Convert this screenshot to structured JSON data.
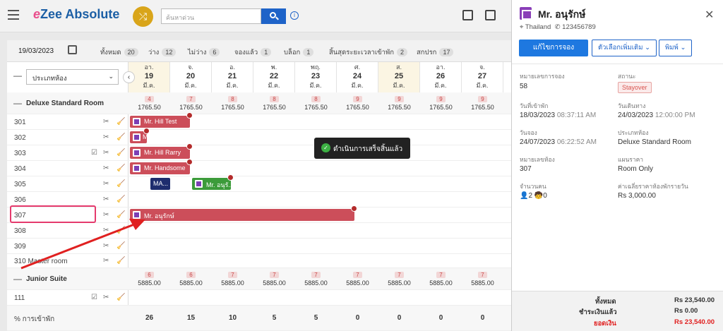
{
  "header": {
    "logo_e": "e",
    "logo_text": "Zee Absolute",
    "search_placeholder": "ค้นหาด่วน"
  },
  "filter": {
    "date": "19/03/2023",
    "stats": [
      {
        "label": "ทั้งหมด",
        "count": "20"
      },
      {
        "label": "ว่าง",
        "count": "12"
      },
      {
        "label": "ไม่ว่าง",
        "count": "6"
      },
      {
        "label": "จองแล้ว",
        "count": "1"
      },
      {
        "label": "บล็อก",
        "count": "1"
      },
      {
        "label": "สิ้นสุดระยะเวลาเข้าพัก",
        "count": "2"
      },
      {
        "label": "สกปรก",
        "count": "17"
      }
    ]
  },
  "grid": {
    "room_type_select": "ประเภทห้อง",
    "days": [
      {
        "dow": "อา.",
        "num": "19",
        "mon": "มี.ค."
      },
      {
        "dow": "จ.",
        "num": "20",
        "mon": "มี.ค."
      },
      {
        "dow": "อ.",
        "num": "21",
        "mon": "มี.ค."
      },
      {
        "dow": "พ.",
        "num": "22",
        "mon": "มี.ค."
      },
      {
        "dow": "พฤ.",
        "num": "23",
        "mon": "มี.ค."
      },
      {
        "dow": "ศ.",
        "num": "24",
        "mon": "มี.ค."
      },
      {
        "dow": "ส.",
        "num": "25",
        "mon": "มี.ค."
      },
      {
        "dow": "อา.",
        "num": "26",
        "mon": "มี.ค."
      },
      {
        "dow": "จ.",
        "num": "27",
        "mon": "มี.ค."
      }
    ],
    "deluxe": {
      "title": "Deluxe Standard Room",
      "avail": [
        "4",
        "7",
        "8",
        "8",
        "8",
        "9",
        "9",
        "9",
        "9"
      ],
      "rates": [
        "1765.50",
        "1765.50",
        "1765.50",
        "1765.50",
        "1765.50",
        "1765.50",
        "1765.50",
        "1765.50",
        "1765.50"
      ]
    },
    "rooms": [
      "301",
      "302",
      "303",
      "304",
      "305",
      "306",
      "307",
      "308",
      "309",
      "310 Master room"
    ],
    "junior": {
      "title": "Junior Suite",
      "avail": [
        "6",
        "6",
        "7",
        "7",
        "7",
        "7",
        "7",
        "7",
        "7"
      ],
      "rates": [
        "5885.00",
        "5885.00",
        "5885.00",
        "5885.00",
        "5885.00",
        "5885.00",
        "5885.00",
        "5885.00",
        "5885.00"
      ]
    },
    "junior_rooms": [
      "111"
    ],
    "occupancy_label": "% การเข้าพัก",
    "occupancy": [
      "26",
      "15",
      "10",
      "5",
      "5",
      "0",
      "0",
      "0",
      "0"
    ],
    "bookings": {
      "b301": "Mr. Hill Test",
      "b302": "M",
      "b303": "Mr. Hill Rarry",
      "b304": "Mr. Handsome",
      "b305a": "MA...",
      "b305b": "Mr. อนุรั...",
      "b307": "Mr. อนุรักษ์"
    }
  },
  "toast": "ดำเนินการเสร็จสิ้นแล้ว",
  "panel": {
    "name": "Mr. อนุรักษ์",
    "country": "Thailand",
    "phone": "123456789",
    "edit_button": "แก้ไขการจอง",
    "more_button": "ตัวเลือกเพิ่มเติม",
    "print_button": "พิมพ์",
    "fields": {
      "booking_no_label": "หมายเลขการจอง",
      "booking_no": "58",
      "status_label": "สถานะ",
      "status": "Stayover",
      "checkin_label": "วันที่เข้าพัก",
      "checkin_date": "18/03/2023",
      "checkin_time": "08:37:11 AM",
      "checkout_label": "วันเดินทาง",
      "checkout_date": "24/03/2023",
      "checkout_time": "12:00:00 PM",
      "reserved_label": "วันจอง",
      "reserved_date": "24/07/2023",
      "reserved_time": "06:22:52 AM",
      "roomtype_label": "ประเภทห้อง",
      "roomtype": "Deluxe Standard Room",
      "roomno_label": "หมายเลขห้อง",
      "roomno": "307",
      "rateplan_label": "แผนราคา",
      "rateplan": "Room Only",
      "pax_label": "จำนวนคน",
      "adults": "2",
      "children": "0",
      "avgrate_label": "ค่าเฉลี่ยราคาห้องพักรายวัน",
      "avgrate": "Rs 3,000.00"
    },
    "totals": {
      "total_label": "ทั้งหมด",
      "total": "Rs 23,540.00",
      "paid_label": "ชำระเงินแล้ว",
      "paid": "Rs 0.00",
      "balance_label": "ยอดเงิน",
      "balance": "Rs 23,540.00"
    }
  },
  "colors": {
    "accent": "#1e78e0",
    "booking_red": "#cc4e5a",
    "highlight": "#e53a6d",
    "arrow": "#e02020"
  }
}
